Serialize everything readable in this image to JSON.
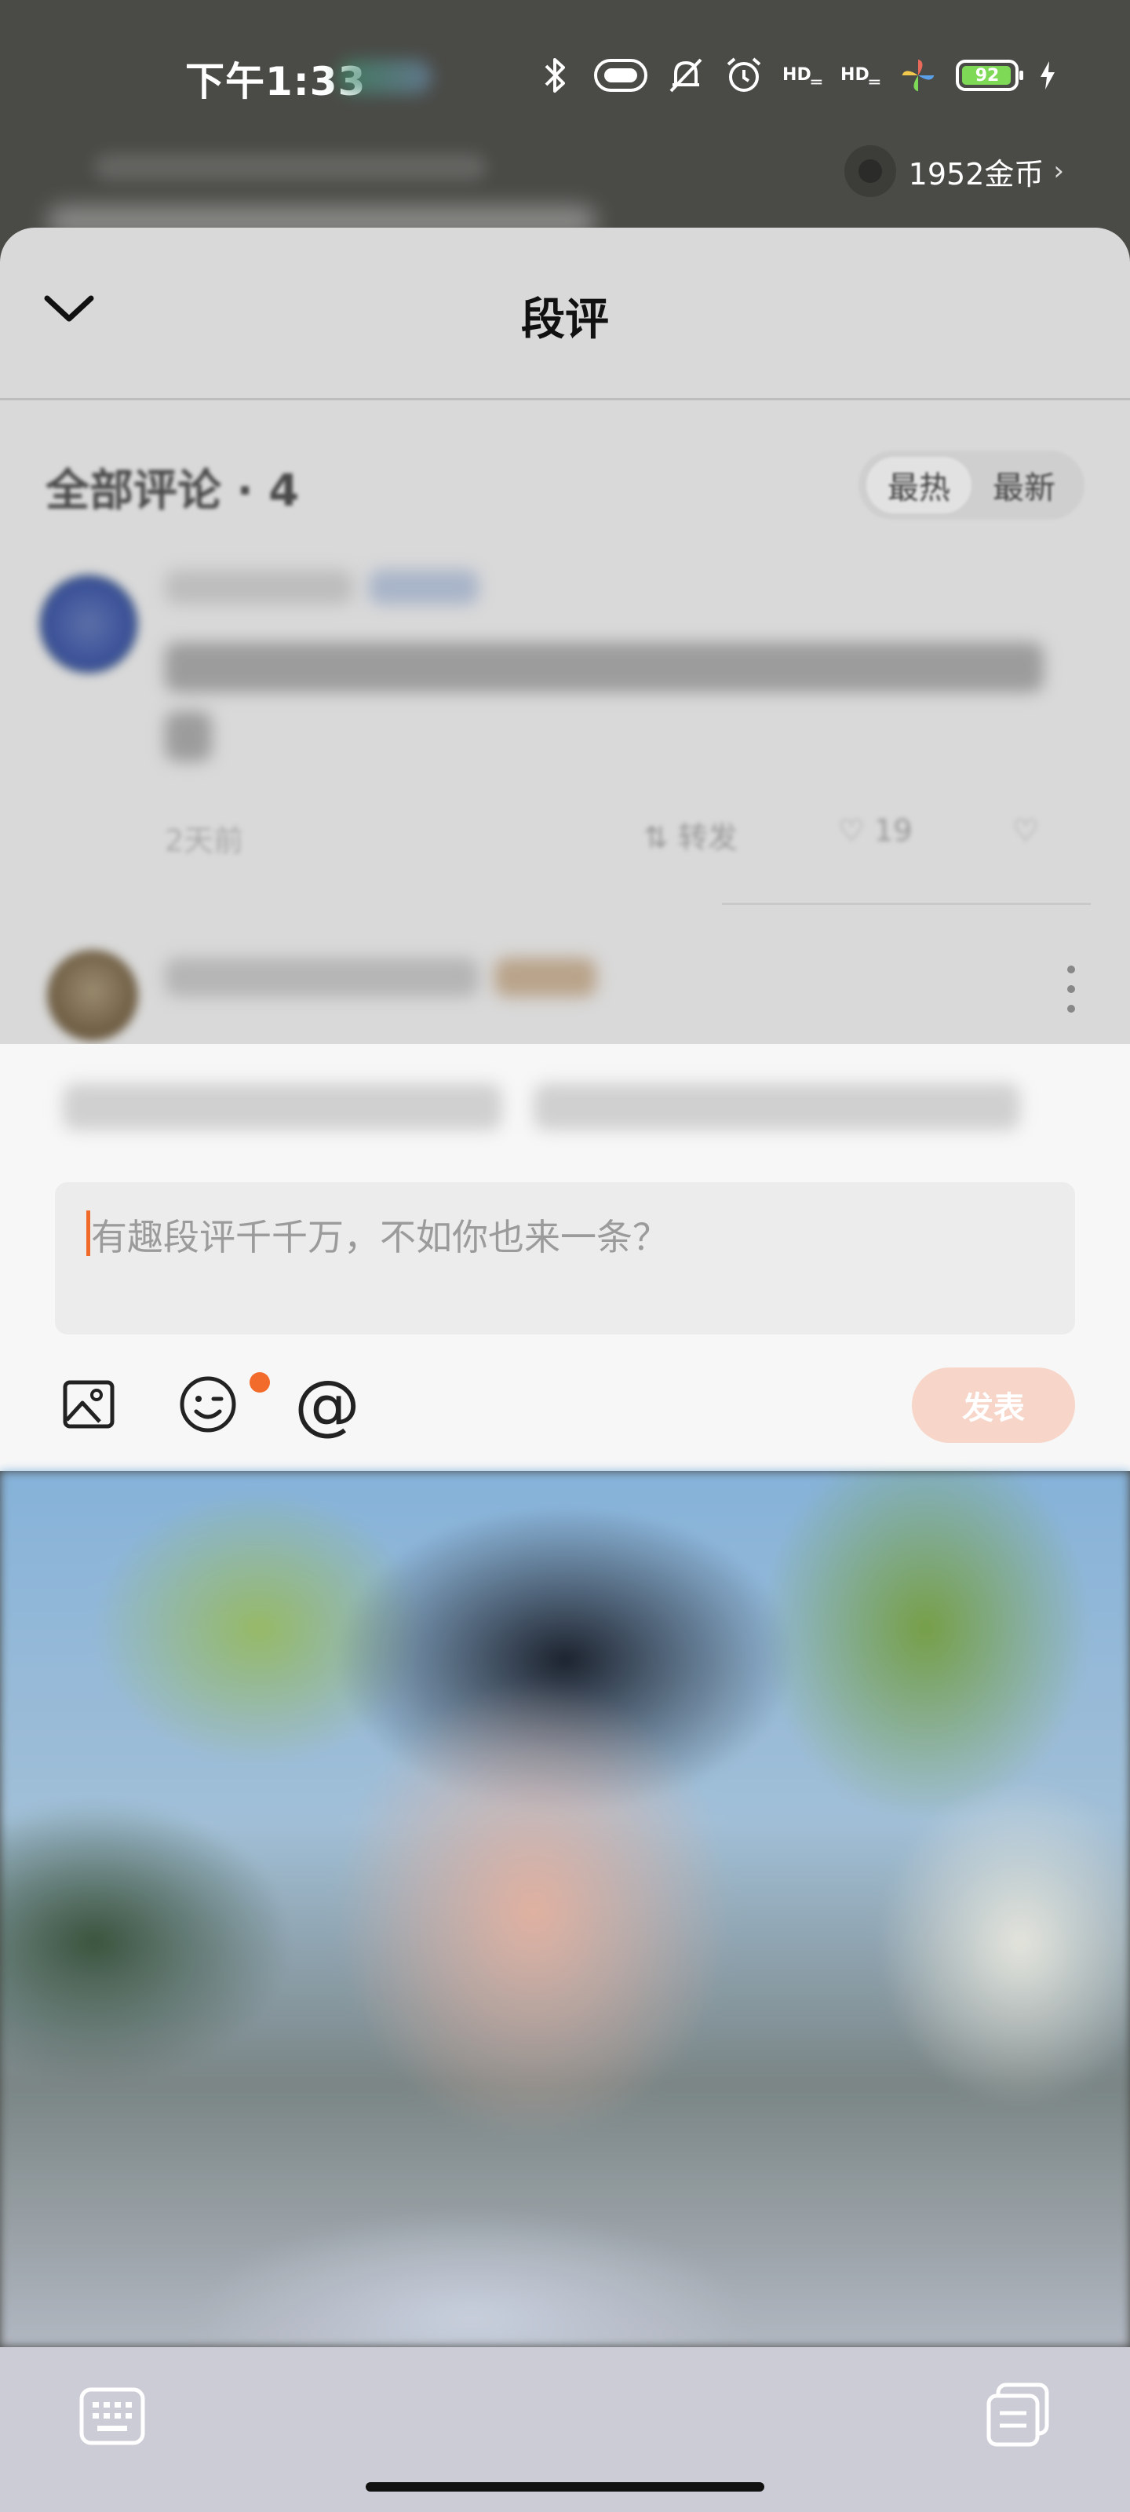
{
  "status_bar": {
    "time": "下午1:33",
    "battery_level": "92",
    "icons": [
      "bluetooth-icon",
      "nfc-icon",
      "mute-icon",
      "alarm-icon",
      "hd-signal-icon",
      "hd-signal-icon",
      "pinwheel-icon",
      "battery-icon",
      "charging-icon"
    ],
    "hd_label": "HD"
  },
  "header": {
    "coins": "1952金币"
  },
  "comment_sheet": {
    "title": "段评",
    "all_comments_label": "全部评论",
    "comment_count": "4",
    "separator": " · ",
    "sort_options": [
      "最热",
      "最新"
    ],
    "active_sort": "最热",
    "comment1": {
      "time": "2天前",
      "forward_label": "转发",
      "likes": "19"
    }
  },
  "compose": {
    "placeholder": "有趣段评千千万，不如你也来一条？",
    "publish_label": "发表",
    "at_symbol": "@"
  },
  "colors": {
    "accent": "#f26b2a",
    "publish_disabled": "#f7d5c8",
    "sheet_bg": "#d9d9d9",
    "status_bg": "#4a4b47"
  }
}
